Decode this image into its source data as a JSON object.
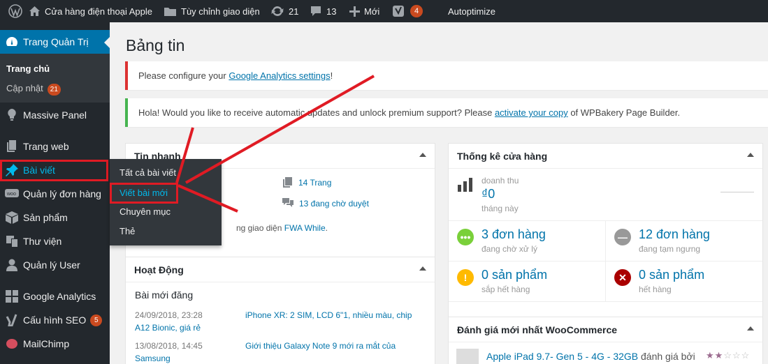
{
  "adminbar": {
    "site_name": "Cửa hàng điện thoại Apple",
    "customize": "Tùy chỉnh giao diện",
    "updates_count": "21",
    "comments_count": "13",
    "new_label": "Mới",
    "yoast_badge": "4",
    "autoptimize": "Autoptimize"
  },
  "sidebar": {
    "dashboard": "Trang Quản Trị",
    "home": "Trang chủ",
    "updates": "Cập nhật",
    "updates_badge": "21",
    "massive_panel": "Massive Panel",
    "website": "Trang web",
    "posts": "Bài viết",
    "orders": "Quản lý đơn hàng",
    "products": "Sản phẩm",
    "library": "Thư viện",
    "users": "Quản lý User",
    "google_analytics": "Google Analytics",
    "seo": "Cấu hình SEO",
    "seo_badge": "5",
    "mailchimp": "MailChimp"
  },
  "flyout": {
    "all_posts": "Tất cả bài viết",
    "new_post": "Viết bài mới",
    "categories": "Chuyên mục",
    "tags": "Thẻ"
  },
  "main": {
    "title": "Bảng tin",
    "notice1_pre": "Please configure your ",
    "notice1_link": "Google Analytics settings",
    "notice1_post": "!",
    "notice2_pre": "Hola! Would you like to receive automatic updates and unlock premium support? Please ",
    "notice2_link": "activate your copy",
    "notice2_post": " of WPBakery Page Builder."
  },
  "glance": {
    "title": "Tin nhanh",
    "pages": "14 Trang",
    "pending": "13 đang chờ duyệt",
    "theme_pre": "ng giao diện ",
    "theme_link": "FWA While",
    "theme_post": "."
  },
  "activity": {
    "title": "Hoạt Động",
    "recent": "Bài mới đăng",
    "items": [
      {
        "date": "24/09/2018, 23:28",
        "title": "iPhone XR: 2 SIM, LCD 6\"1, nhiều màu, chip A12 Bionic, giá rẻ",
        "title_l1": "iPhone XR: 2 SIM, LCD 6\"1, nhiều màu, chip",
        "title_l2": "A12 Bionic, giá rẻ"
      },
      {
        "date": "13/08/2018, 14:45",
        "title": "Giới thiệu Galaxy Note 9 mới ra mắt của Samsung",
        "title_l1": "Giới thiệu Galaxy Note 9 mới ra mắt của",
        "title_l2": "Samsung"
      }
    ]
  },
  "store": {
    "title": "Thống kê cửa hàng",
    "revenue_label": "doanh thu",
    "revenue_value": "₫0",
    "revenue_period": "tháng này",
    "processing_big": "3 đơn hàng",
    "processing_small": "đang chờ xử lý",
    "onhold_big": "12 đơn hàng",
    "onhold_small": "đang tạm ngưng",
    "lowstock_big": "0 sản phẩm",
    "lowstock_small": "sắp hết hàng",
    "outstock_big": "0 sản phẩm",
    "outstock_small": "hết hàng"
  },
  "reviews": {
    "title": "Đánh giá mới nhất WooCommerce",
    "item_link": "Apple iPad 9.7- Gen 5 - 4G - 32GB",
    "item_post": " đánh giá bởi",
    "rating": 2,
    "rating_max": 5
  },
  "colors": {
    "adminbar_bg": "#23282d",
    "accent": "#0073aa",
    "badge": "#ca4a1f",
    "annotation_red": "#e01b24",
    "green": "#7ad03a",
    "gray": "#999999",
    "yellow": "#ffba00",
    "red": "#a00000"
  }
}
